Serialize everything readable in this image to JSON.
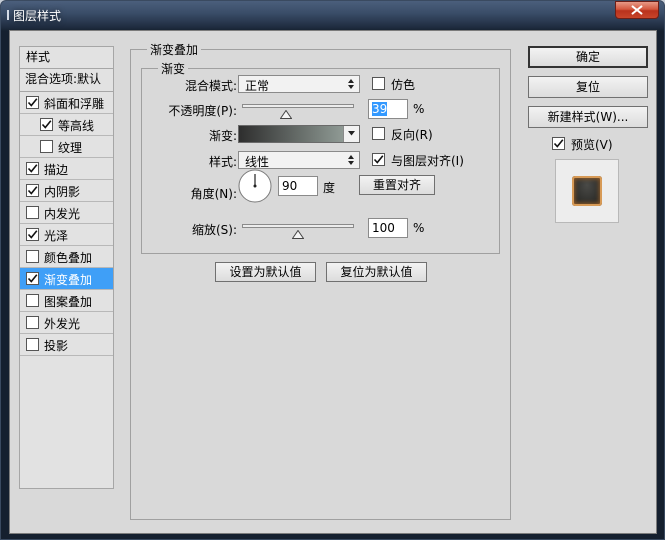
{
  "window": {
    "title": "图层样式"
  },
  "left_panel": {
    "header_label": "样式",
    "blend_options_label": "混合选项:默认",
    "items": [
      {
        "label": "斜面和浮雕",
        "checked": true,
        "selected": false,
        "indent": false
      },
      {
        "label": "等高线",
        "checked": true,
        "selected": false,
        "indent": true
      },
      {
        "label": "纹理",
        "checked": false,
        "selected": false,
        "indent": true
      },
      {
        "label": "描边",
        "checked": true,
        "selected": false,
        "indent": false
      },
      {
        "label": "内阴影",
        "checked": true,
        "selected": false,
        "indent": false
      },
      {
        "label": "内发光",
        "checked": false,
        "selected": false,
        "indent": false
      },
      {
        "label": "光泽",
        "checked": true,
        "selected": false,
        "indent": false
      },
      {
        "label": "颜色叠加",
        "checked": false,
        "selected": false,
        "indent": false
      },
      {
        "label": "渐变叠加",
        "checked": true,
        "selected": true,
        "indent": false
      },
      {
        "label": "图案叠加",
        "checked": false,
        "selected": false,
        "indent": false
      },
      {
        "label": "外发光",
        "checked": false,
        "selected": false,
        "indent": false
      },
      {
        "label": "投影",
        "checked": false,
        "selected": false,
        "indent": false
      }
    ]
  },
  "gradient_overlay": {
    "section_title": "渐变叠加",
    "group_title": "渐变",
    "blend_mode": {
      "label": "混合模式:",
      "value": "正常"
    },
    "dither": {
      "label": "仿色",
      "checked": false
    },
    "opacity": {
      "label": "不透明度(P):",
      "value": "39",
      "unit": "%",
      "fraction": 0.39
    },
    "gradient": {
      "label": "渐变:",
      "color_start": "#2e2e2e",
      "color_end": "#8f9a94"
    },
    "reverse": {
      "label": "反向(R)",
      "checked": false
    },
    "style": {
      "label": "样式:",
      "value": "线性"
    },
    "align_with_layer": {
      "label": "与图层对齐(I)",
      "checked": true
    },
    "angle": {
      "label": "角度(N):",
      "value": "90",
      "unit": "度"
    },
    "reset_alignment_label": "重置对齐",
    "scale": {
      "label": "缩放(S):",
      "value": "100",
      "unit": "%",
      "fraction": 0.5
    },
    "make_default_label": "设置为默认值",
    "reset_default_label": "复位为默认值"
  },
  "right_panel": {
    "ok_label": "确定",
    "reset_label": "复位",
    "new_style_label": "新建样式(W)...",
    "preview": {
      "label": "预览(V)",
      "checked": true
    }
  },
  "colors": {
    "selected_item": "#3f9ff7",
    "panel_bg": "#d9d9d9",
    "close_button": "#c8452a"
  }
}
